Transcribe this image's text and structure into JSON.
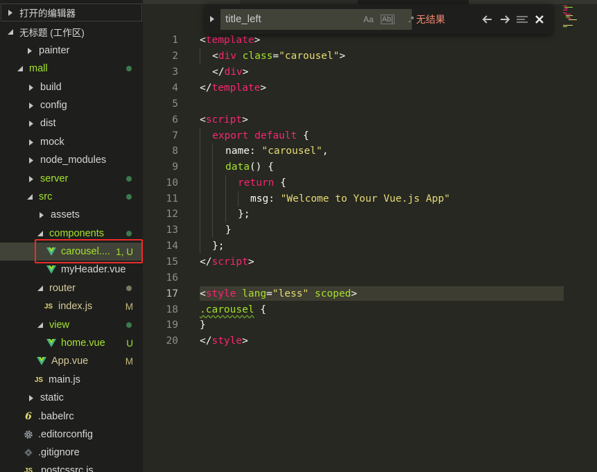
{
  "sidebar": {
    "open_editors_label": "打开的编辑器",
    "workspace_label": "无标题 (工作区)",
    "items": [
      {
        "label": "painter",
        "icon": "caret-right-icon"
      },
      {
        "label": "mall",
        "icon": "caret-down-icon",
        "status_dot": "green"
      },
      {
        "label": "build",
        "icon": "caret-right-icon"
      },
      {
        "label": "config",
        "icon": "caret-right-icon"
      },
      {
        "label": "dist",
        "icon": "caret-right-icon"
      },
      {
        "label": "mock",
        "icon": "caret-right-icon"
      },
      {
        "label": "node_modules",
        "icon": "caret-right-icon"
      },
      {
        "label": "server",
        "icon": "caret-right-icon",
        "status_dot": "green"
      },
      {
        "label": "src",
        "icon": "caret-down-icon",
        "status_dot": "green"
      },
      {
        "label": "assets",
        "icon": "caret-right-icon"
      },
      {
        "label": "components",
        "icon": "caret-down-icon",
        "status_dot": "green"
      },
      {
        "label": "carousel....",
        "icon": "vue-icon",
        "badge": "1, U"
      },
      {
        "label": "myHeader.vue",
        "icon": "vue-icon"
      },
      {
        "label": "router",
        "icon": "caret-down-icon",
        "status_dot": "gray"
      },
      {
        "label": "index.js",
        "icon": "js-icon",
        "badge": "M"
      },
      {
        "label": "view",
        "icon": "caret-down-icon",
        "status_dot": "green"
      },
      {
        "label": "home.vue",
        "icon": "vue-icon",
        "badge": "U"
      },
      {
        "label": "App.vue",
        "icon": "vue-icon",
        "badge": "M"
      },
      {
        "label": "main.js",
        "icon": "js-icon"
      },
      {
        "label": "static",
        "icon": "caret-right-icon"
      },
      {
        "label": ".babelrc",
        "icon": "babel-icon"
      },
      {
        "label": ".editorconfig",
        "icon": "gear-icon"
      },
      {
        "label": ".gitignore",
        "icon": "git-icon"
      },
      {
        "label": ".postcssrc.js",
        "icon": "js-icon"
      }
    ]
  },
  "find": {
    "value": "title_left",
    "match_case_label": "Aa",
    "whole_word_label": "Ab|",
    "regex_label": ".*",
    "status": "无结果"
  },
  "editor": {
    "line_numbers": [
      "1",
      "2",
      "3",
      "4",
      "5",
      "6",
      "7",
      "8",
      "9",
      "10",
      "11",
      "12",
      "13",
      "14",
      "15",
      "16",
      "17",
      "18",
      "19",
      "20"
    ],
    "active_line": "17"
  },
  "code": {
    "l1_open": "<",
    "l1_tag": "template",
    "l1_close": ">",
    "l2_open": "<",
    "l2_tag": "div",
    "l2_attr": "class",
    "l2_eq": "=",
    "l2_str": "\"carousel\"",
    "l2_close": ">",
    "l3_open": "</",
    "l3_tag": "div",
    "l3_close": ">",
    "l4_open": "</",
    "l4_tag": "template",
    "l4_close": ">",
    "l6_open": "<",
    "l6_tag": "script",
    "l6_close": ">",
    "l7_kw1": "export",
    "l7_kw2": "default",
    "l7_brace": "{",
    "l8_key": "name",
    "l8_colon": ": ",
    "l8_str": "\"carousel\"",
    "l8_comma": ",",
    "l9_fn": "data",
    "l9_rest": "() {",
    "l10_kw": "return",
    "l10_brace": " {",
    "l11_key": "msg",
    "l11_colon": ": ",
    "l11_str": "\"Welcome to Your Vue.js App\"",
    "l12": "};",
    "l13": "}",
    "l14": "};",
    "l15_open": "</",
    "l15_tag": "script",
    "l15_close": ">",
    "l17_open": "<",
    "l17_tag": "style",
    "l17_attr1": "lang",
    "l17_eq": "=",
    "l17_str": "\"less\"",
    "l17_attr2": "scoped",
    "l17_close": ">",
    "l18_sel": ".carousel",
    "l18_brace": " {",
    "l19": "}",
    "l20_open": "</",
    "l20_tag": "style",
    "l20_close": ">"
  },
  "colors": {
    "background": "#272822",
    "sidebar_bg": "#1e1f1c",
    "tag": "#f92672",
    "string": "#e6db74",
    "attribute": "#a6e22e",
    "no_results": "#f48771",
    "highlight_border": "#ef2b2b"
  }
}
